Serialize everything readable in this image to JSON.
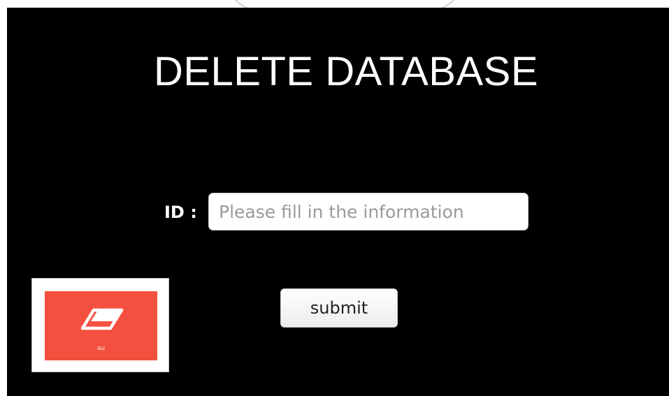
{
  "page": {
    "title": "DELETE DATABASE"
  },
  "form": {
    "id_label": "ID :",
    "id_input": {
      "value": "",
      "placeholder": "Please fill in the information"
    },
    "submit_label": "submit"
  },
  "logo": {
    "icon": "eraser-icon",
    "caption": "au"
  },
  "colors": {
    "background": "#000000",
    "logo_tile": "#f4503f",
    "title_text": "#ffffff"
  }
}
